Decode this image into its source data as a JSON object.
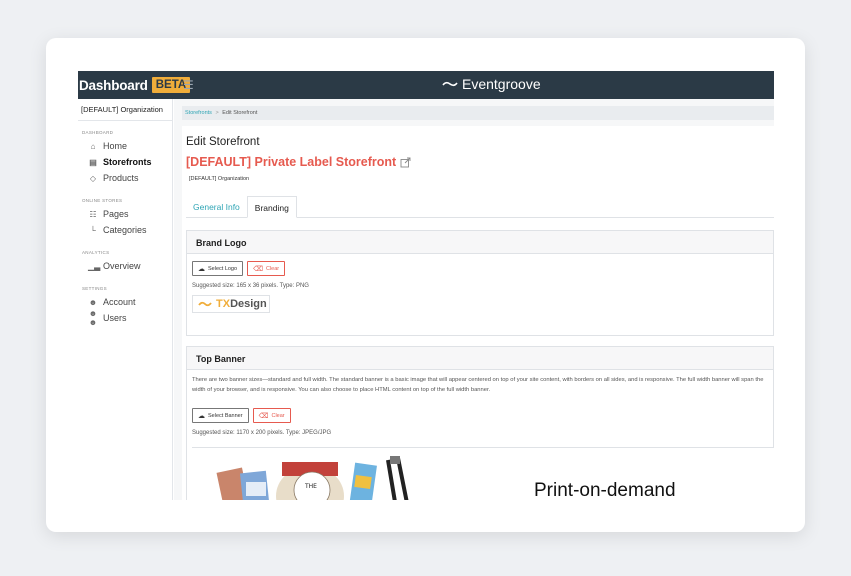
{
  "topbar": {
    "brand": "Dashboard",
    "badge": "BETA",
    "menu_icon": "hamburger-icon",
    "logo_text": "Eventgroove"
  },
  "sidebar": {
    "org": "[DEFAULT] Organization",
    "sections": [
      {
        "title": "DASHBOARD",
        "items": [
          {
            "label": "Home",
            "icon": "home-icon"
          },
          {
            "label": "Storefronts",
            "icon": "storefront-icon",
            "active": true
          },
          {
            "label": "Products",
            "icon": "tag-icon"
          }
        ]
      },
      {
        "title": "ONLINE STORES",
        "items": [
          {
            "label": "Pages",
            "icon": "pages-icon"
          },
          {
            "label": "Categories",
            "icon": "categories-icon"
          }
        ]
      },
      {
        "title": "ANALYTICS",
        "items": [
          {
            "label": "Overview",
            "icon": "chart-icon"
          }
        ]
      },
      {
        "title": "SETTINGS",
        "items": [
          {
            "label": "Account",
            "icon": "account-icon"
          },
          {
            "label": "Users",
            "icon": "users-icon"
          }
        ]
      }
    ]
  },
  "breadcrumb": {
    "link": "Storefronts",
    "separator": ">",
    "current": "Edit Storefront"
  },
  "page": {
    "title": "Edit Storefront",
    "store_title": "[DEFAULT] Private Label Storefront",
    "store_org": "[DEFAULT] Organization",
    "tabs": [
      {
        "label": "General Info",
        "active": false
      },
      {
        "label": "Branding",
        "active": true
      }
    ]
  },
  "brand_logo": {
    "heading": "Brand Logo",
    "select_label": "Select Logo",
    "clear_label": "Clear",
    "hint": "Suggested size: 165 x 36 pixels. Type: PNG",
    "logo_prefix": "TX",
    "logo_suffix": "Design"
  },
  "top_banner": {
    "heading": "Top Banner",
    "description": "There are two banner sizes—standard and full width. The standard banner is a basic image that will appear centered on top of your site content, with borders on all sides, and is responsive. The full width banner will span the width of your browser, and is responsive. You can also choose to place HTML content on top of the full width banner.",
    "select_label": "Select Banner",
    "clear_label": "Clear",
    "hint": "Suggested size: 1170 x 200 pixels. Type: JPEG/JPG",
    "banner_text": "Print-on-demand",
    "banner_small_text": "THE"
  },
  "colors": {
    "topbar": "#2b3a46",
    "beta": "#f0ad3a",
    "accent_teal": "#2fa5b5",
    "accent_red": "#e65a4f"
  }
}
